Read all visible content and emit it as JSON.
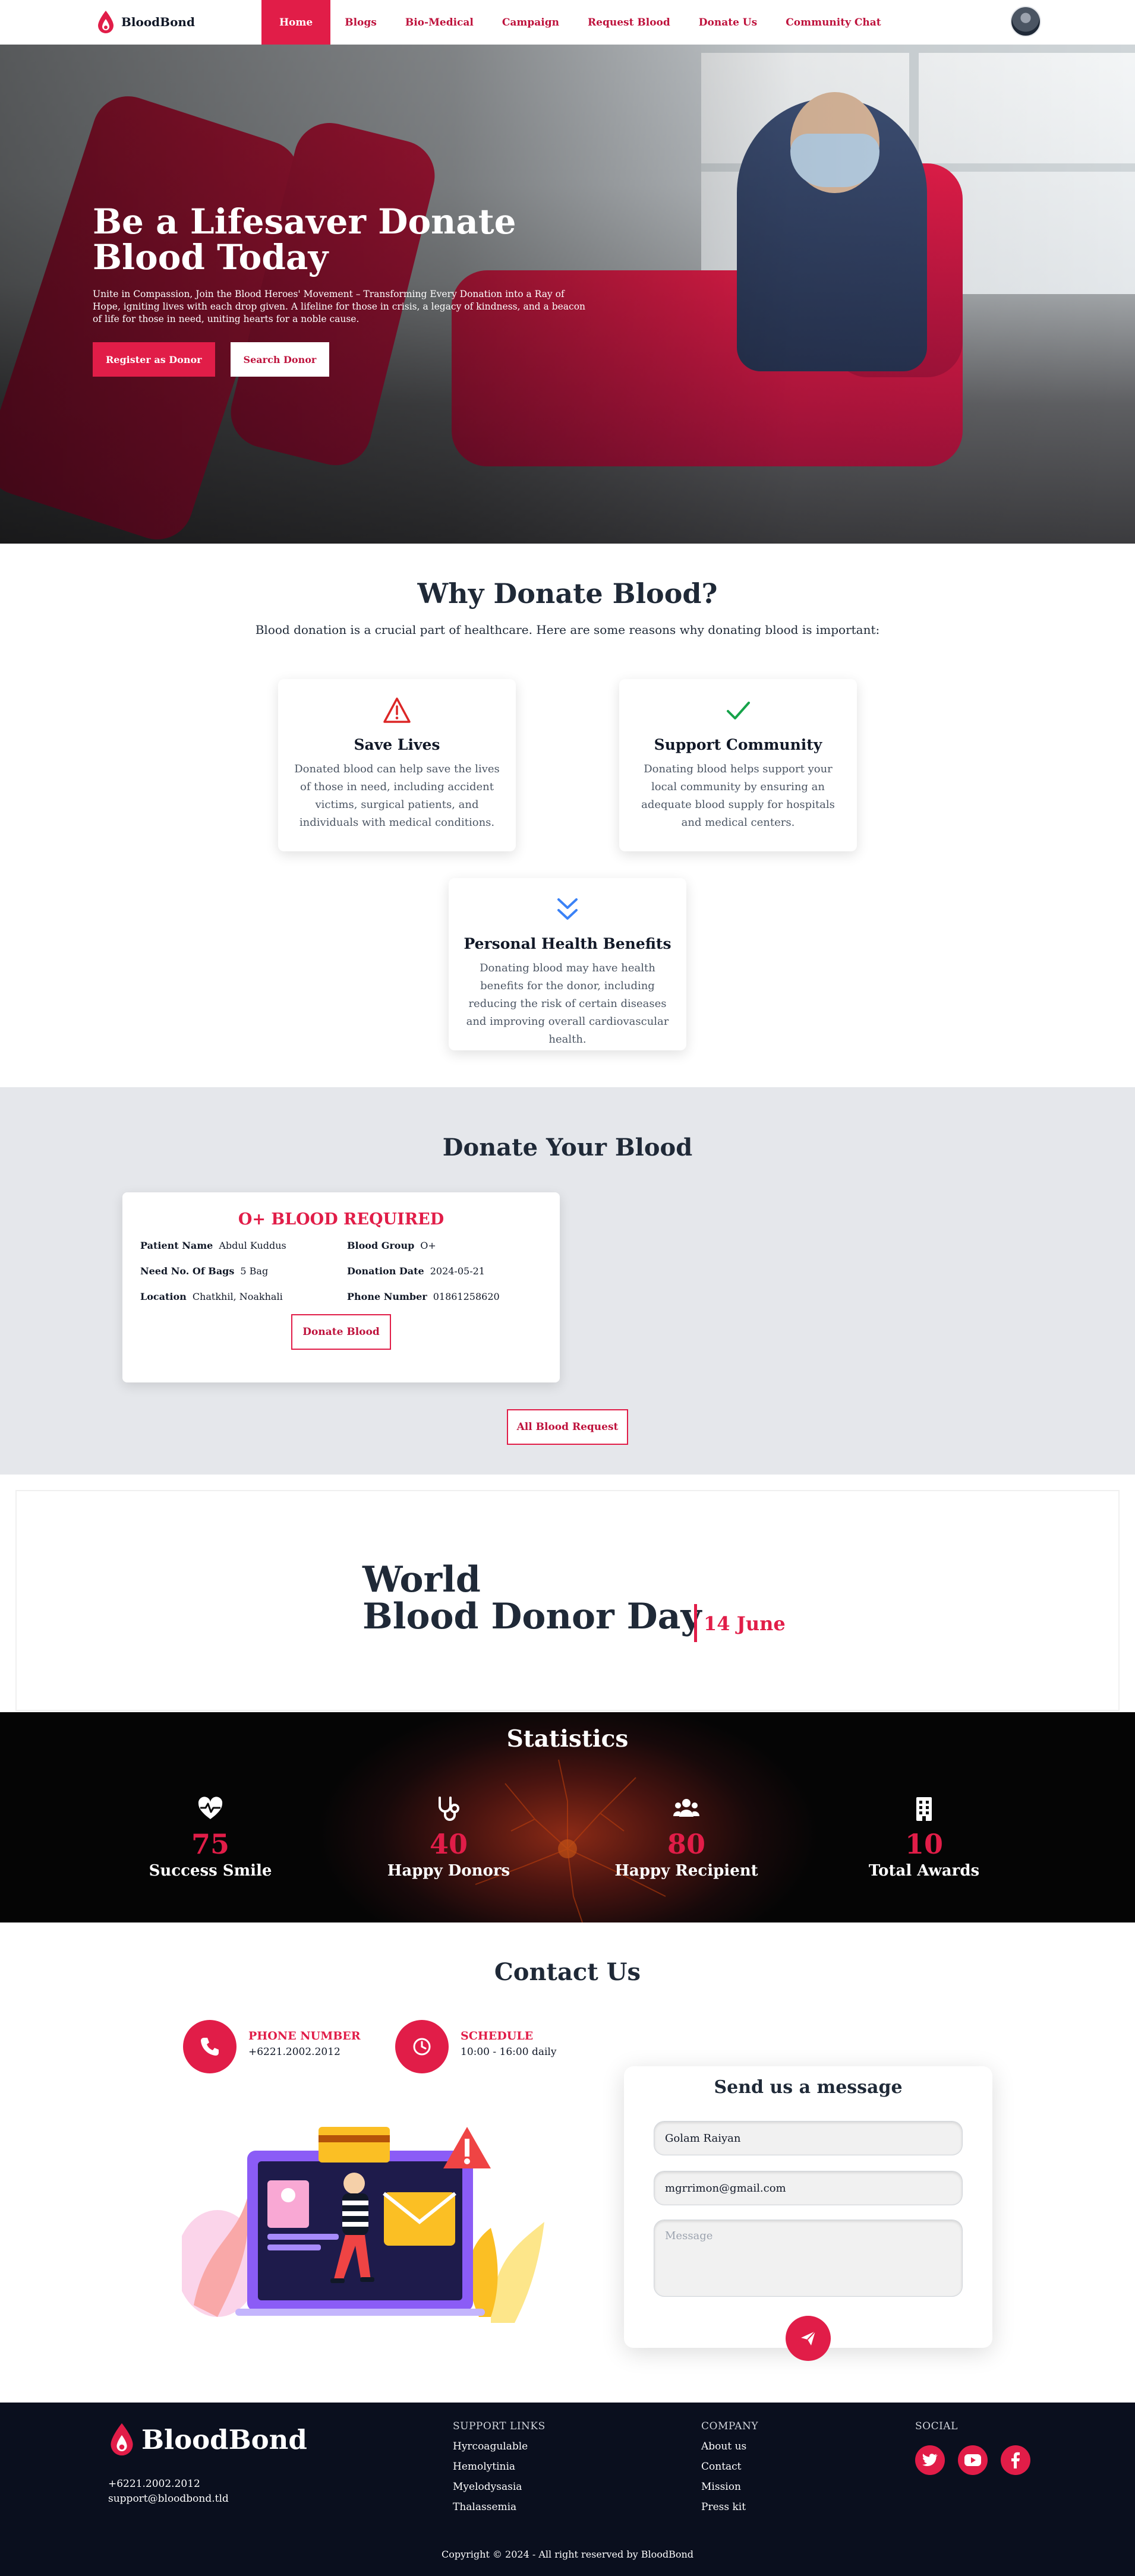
{
  "brand": {
    "name_part1": "Blood",
    "name_part2": "Bond"
  },
  "nav": {
    "links": [
      "Home",
      "Blogs",
      "Bio-Medical",
      "Campaign",
      "Request Blood",
      "Donate Us",
      "Community Chat"
    ],
    "active": "Home"
  },
  "hero": {
    "title_line1": "Be a Lifesaver Donate",
    "title_line2": "Blood Today",
    "subtitle": "Unite in Compassion, Join the Blood Heroes' Movement – Transforming Every Donation into a Ray of Hope, igniting lives with each drop given. A lifeline for those in crisis, a legacy of kindness, and a beacon of life for those in need, uniting hearts for a noble cause.",
    "primary_button": "Register as Donor",
    "secondary_button": "Search Donor"
  },
  "why": {
    "title": "Why Donate Blood?",
    "subtitle": "Blood donation is a crucial part of healthcare. Here are some reasons why donating blood is important:",
    "cards": [
      {
        "icon": "warning-triangle-icon",
        "title": "Save Lives",
        "text": "Donated blood can help save the lives of those in need, including accident victims, surgical patients, and individuals with medical conditions.",
        "color": "#dc2626"
      },
      {
        "icon": "check-icon",
        "title": "Support Community",
        "text": "Donating blood helps support your local community by ensuring an adequate blood supply for hospitals and medical centers.",
        "color": "#16a34a"
      },
      {
        "icon": "double-chevron-down-icon",
        "title": "Personal Health Benefits",
        "text": "Donating blood may have health benefits for the donor, including reducing the risk of certain diseases and improving overall cardiovascular health.",
        "color": "#3b82f6"
      }
    ]
  },
  "donate": {
    "title": "Donate Your Blood",
    "request": {
      "heading": "O+ BLOOD REQUIRED",
      "patient_label": "Patient Name",
      "patient_value": "Abdul Kuddus",
      "group_label": "Blood Group",
      "group_value": "O+",
      "bags_label": "Need No. Of Bags",
      "bags_value": "5 Bag",
      "date_label": "Donation Date",
      "date_value": "2024-05-21",
      "location_label": "Location",
      "location_value": "Chatkhil, Noakhali",
      "phone_label": "Phone Number",
      "phone_value": "01861258620",
      "button": "Donate Blood"
    },
    "all_button": "All Blood Request"
  },
  "wdd": {
    "line1": "World",
    "line2": "Blood Donor Day",
    "date": "14 June"
  },
  "stats": {
    "title": "Statistics",
    "items": [
      {
        "icon": "heart-pulse-icon",
        "value": "75",
        "label": "Success Smile"
      },
      {
        "icon": "stethoscope-icon",
        "value": "40",
        "label": "Happy Donors"
      },
      {
        "icon": "users-icon",
        "value": "80",
        "label": "Happy Recipient"
      },
      {
        "icon": "building-icon",
        "value": "10",
        "label": "Total Awards"
      }
    ]
  },
  "contact": {
    "title": "Contact Us",
    "phone_label": "PHONE NUMBER",
    "phone_value": "+6221.2002.2012",
    "schedule_label": "SCHEDULE",
    "schedule_value": "10:00 - 16:00 daily",
    "form": {
      "title": "Send us a message",
      "name_value": "Golam Raiyan",
      "email_value": "mgrrimon@gmail.com",
      "message_placeholder": "Message"
    }
  },
  "footer": {
    "brand": "BloodBond",
    "phone": "+6221.2002.2012",
    "email": "support@bloodbond.tld",
    "support_title": "SUPPORT LINKS",
    "support_links": [
      "Hyrcoagulable",
      "Hemolytinia",
      "Myelodysasia",
      "Thalassemia"
    ],
    "company_title": "COMPANY",
    "company_links": [
      "About us",
      "Contact",
      "Mission",
      "Press kit"
    ],
    "social_title": "SOCIAL",
    "copyright": "Copyright © 2024 - All right reserved by BloodBond"
  },
  "colors": {
    "primary": "#e11d48",
    "dark": "#0a0f1e",
    "section_gray": "#e5e7eb"
  }
}
